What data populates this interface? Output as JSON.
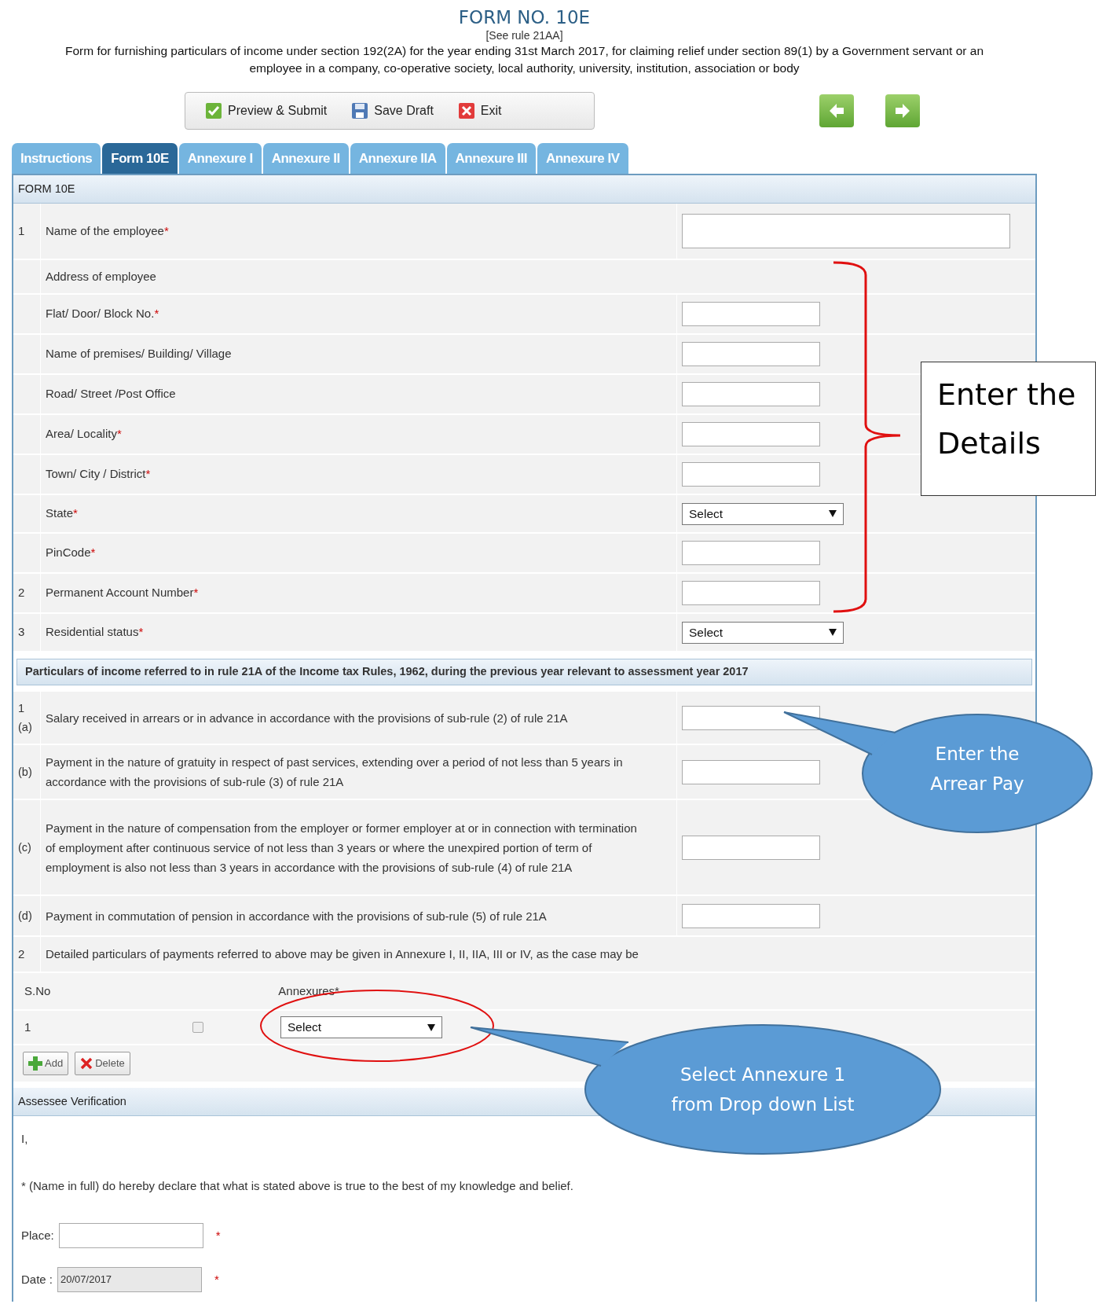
{
  "header": {
    "title": "FORM NO. 10E",
    "rule": "[See rule 21AA]",
    "description": "Form for furnishing particulars of income under section 192(2A) for the year ending 31st March 2017, for claiming relief under section 89(1) by a Government servant or an employee in a company, co-operative society, local authority, university, institution, association or body"
  },
  "toolbar": [
    {
      "kind": "check",
      "label": "Preview & Submit"
    },
    {
      "kind": "save",
      "label": "Save Draft"
    },
    {
      "kind": "exit",
      "label": "Exit"
    }
  ],
  "nav_arrows": [
    {
      "kind": "back"
    },
    {
      "kind": "forward"
    }
  ],
  "tabs": [
    {
      "label": "Instructions",
      "selected": false
    },
    {
      "label": "Form 10E",
      "selected": true
    },
    {
      "label": "Annexure I",
      "selected": false
    },
    {
      "label": "Annexure II",
      "selected": false
    },
    {
      "label": "Annexure IIA",
      "selected": false
    },
    {
      "label": "Annexure III",
      "selected": false
    },
    {
      "label": "Annexure IV",
      "selected": false
    }
  ],
  "section_title": "FORM 10E",
  "rows": [
    {
      "number": "1",
      "label": "Name of the employee",
      "mark": "*",
      "kind": "wide"
    },
    {
      "label": "Address of employee",
      "kind": "heading"
    },
    {
      "label": "Flat/ Door/ Block No.",
      "mark": "*",
      "kind": "text"
    },
    {
      "label": "Name of premises/ Building/ Village",
      "kind": "text"
    },
    {
      "label": "Road/ Street /Post Office",
      "kind": "text"
    },
    {
      "label": "Area/ Locality",
      "mark": "*",
      "kind": "text"
    },
    {
      "label": "Town/ City / District",
      "mark": "*",
      "kind": "text"
    },
    {
      "label": "State",
      "mark": "*",
      "kind": "select",
      "value": "Select"
    },
    {
      "label": "PinCode",
      "mark": "*",
      "kind": "text"
    },
    {
      "number": "2",
      "label": "Permanent Account Number",
      "mark": "*",
      "kind": "text"
    },
    {
      "number": "3",
      "label": "Residential status",
      "mark": "*",
      "kind": "select",
      "value": "Select"
    }
  ],
  "particulars": {
    "title": "Particulars of income referred to in rule 21A of the Income tax Rules, 1962, during the previous year relevant to assessment year 2017",
    "rows": [
      {
        "number": "1",
        "sub": "(a)",
        "text": "Salary received in arrears or in advance in accordance with the provisions of sub-rule (2) of rule 21A"
      },
      {
        "sub": "(b)",
        "text": "Payment in the nature of gratuity in respect of past services, extending over a period of not less than 5 years in accordance with the provisions of sub-rule (3) of rule 21A"
      },
      {
        "sub": "(c)",
        "text": "Payment in the nature of compensation from the employer or former employer at or in connection with termination of employment after continuous service of not less than 3 years or where the unexpired portion of term of employment is also not less than 3 years in accordance with the provisions of sub-rule (4) of rule 21A"
      },
      {
        "sub": "(d)",
        "text": "Payment in commutation of pension in accordance with the provisions of sub-rule (5) of rule 21A"
      }
    ],
    "note": {
      "number": "2",
      "text": "Detailed particulars of payments referred to above may be given in Annexure I, II, IIA, III or IV, as the case may be"
    }
  },
  "annexures": {
    "columns": [
      "S.No",
      "Annexures*"
    ],
    "rows": [
      {
        "sno": "1",
        "checked": false,
        "value": "Select"
      }
    ],
    "buttons": [
      {
        "kind": "add",
        "label": "Add"
      },
      {
        "kind": "delete",
        "label": "Delete"
      }
    ]
  },
  "verification": {
    "title": "Assessee Verification",
    "intro": "I,",
    "declaration": "* (Name in full) do hereby declare that what is stated above is true to the best of my knowledge and belief.",
    "fields": [
      {
        "label": "Place:",
        "disabled": false,
        "mark": "*"
      },
      {
        "label": "Date :",
        "value": "20/07/2017",
        "disabled": true,
        "mark": "*"
      }
    ]
  },
  "annotations": {
    "details_box": "Enter the Details",
    "callouts": [
      "Enter the\nArrear Pay",
      "Select Annexure 1\nfrom Drop down List"
    ]
  }
}
